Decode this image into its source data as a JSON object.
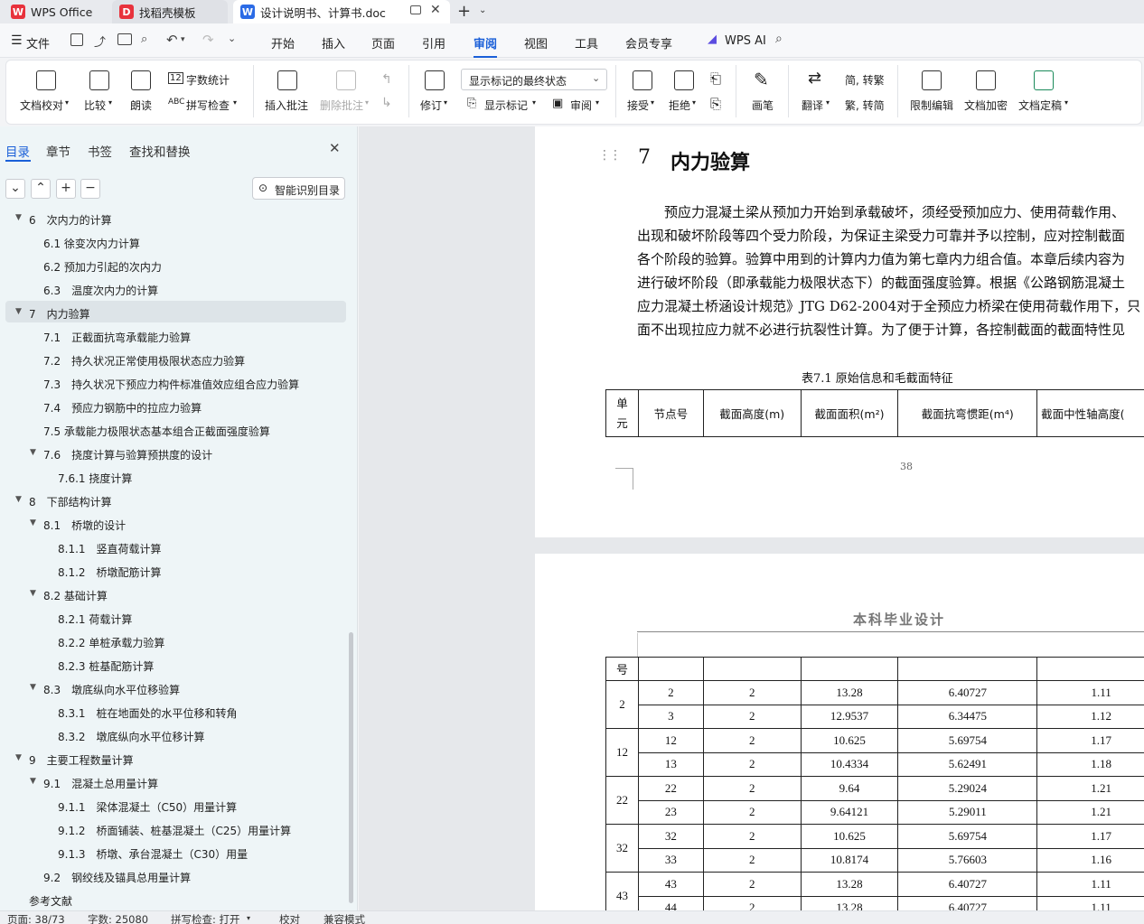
{
  "tabs": {
    "home": "WPS Office",
    "template": "找稻壳模板",
    "doc": "设计说明书、计算书.doc"
  },
  "menu": {
    "file": "文件",
    "items": [
      "开始",
      "插入",
      "页面",
      "引用",
      "审阅",
      "视图",
      "工具",
      "会员专享"
    ],
    "active": "审阅",
    "ai": "WPS AI"
  },
  "ribbon": {
    "proof": "文档校对",
    "compare": "比较",
    "read": "朗读",
    "wordcount": "字数统计",
    "spellcheck": "拼写检查",
    "insert_comment": "插入批注",
    "delete_comment": "删除批注",
    "revise": "修订",
    "display_select": "显示标记的最终状态",
    "show_markup": "显示标记",
    "review": "审阅",
    "accept": "接受",
    "reject": "拒绝",
    "pen": "画笔",
    "translate": "翻译",
    "to_trad": "简, 转繁",
    "to_simp": "繁, 转简",
    "restrict": "限制编辑",
    "encrypt": "文档加密",
    "finalize": "文档定稿"
  },
  "panel": {
    "tabs": [
      "目录",
      "章节",
      "书签",
      "查找和替换"
    ],
    "smart_toc": "智能识别目录",
    "toc": [
      "6　次内力的计算",
      "6.1 徐变次内力计算",
      "6.2 预加力引起的次内力",
      "6.3　温度次内力的计算",
      "7　内力验算",
      "7.1　正截面抗弯承载能力验算",
      "7.2　持久状况正常使用极限状态应力验算",
      "7.3　持久状况下预应力构件标准值效应组合应力验算",
      "7.4　预应力钢筋中的拉应力验算",
      "7.5 承载能力极限状态基本组合正截面强度验算",
      "7.6　挠度计算与验算预拱度的设计",
      "7.6.1 挠度计算",
      "8　下部结构计算",
      "8.1　桥墩的设计",
      "8.1.1　竖直荷载计算",
      "8.1.2　桥墩配筋计算",
      "8.2 基础计算",
      "8.2.1 荷载计算",
      "8.2.2 单桩承载力验算",
      "8.2.3 桩基配筋计算",
      "8.3　墩底纵向水平位移验算",
      "8.3.1　桩在地面处的水平位移和转角",
      "8.3.2　墩底纵向水平位移计算",
      "9　主要工程数量计算",
      "9.1　混凝土总用量计算",
      "9.1.1　梁体混凝土（C50）用量计算",
      "9.1.2　桥面铺装、桩基混凝土（C25）用量计算",
      "9.1.3　桥墩、承台混凝土（C30）用量",
      "9.2　钢绞线及锚具总用量计算",
      "参考文献"
    ]
  },
  "doc": {
    "chapter_num": "7",
    "chapter_title": "内力验算",
    "para": [
      "预应力混凝土梁从预加力开始到承载破坏，须经受预加应力、使用荷载作用、",
      "出现和破坏阶段等四个受力阶段，为保证主梁受力可靠并予以控制，应对控制截面",
      "各个阶段的验算。验算中用到的计算内力值为第七章内力组合值。本章后续内容为",
      "进行破坏阶段（即承载能力极限状态下）的截面强度验算。根据《公路钢筋混凝土",
      "应力混凝土桥涵设计规范》JTG D62-2004对于全预应力桥梁在使用荷载作用下，只",
      "面不出现拉应力就不必进行抗裂性计算。为了便于计算，各控制截面的截面特性见"
    ],
    "table_caption": "表7.1  原始信息和毛截面特征",
    "headers": [
      "单元",
      "节点号",
      "截面高度(m)",
      "截面面积(m²)",
      "截面抗弯惯距(m⁴)",
      "截面中性轴高度("
    ],
    "page_number": "38",
    "page2_header": "本科毕业设计",
    "cont_header": "号",
    "rows": [
      {
        "unit": "2",
        "cells": [
          [
            "2",
            "2",
            "13.28",
            "6.40727",
            "1.11"
          ],
          [
            "3",
            "2",
            "12.9537",
            "6.34475",
            "1.12"
          ]
        ]
      },
      {
        "unit": "12",
        "cells": [
          [
            "12",
            "2",
            "10.625",
            "5.69754",
            "1.17"
          ],
          [
            "13",
            "2",
            "10.4334",
            "5.62491",
            "1.18"
          ]
        ]
      },
      {
        "unit": "22",
        "cells": [
          [
            "22",
            "2",
            "9.64",
            "5.29024",
            "1.21"
          ],
          [
            "23",
            "2",
            "9.64121",
            "5.29011",
            "1.21"
          ]
        ]
      },
      {
        "unit": "32",
        "cells": [
          [
            "32",
            "2",
            "10.625",
            "5.69754",
            "1.17"
          ],
          [
            "33",
            "2",
            "10.8174",
            "5.76603",
            "1.16"
          ]
        ]
      },
      {
        "unit": "43",
        "cells": [
          [
            "43",
            "2",
            "13.28",
            "6.40727",
            "1.11"
          ],
          [
            "44",
            "2",
            "13.28",
            "6.40727",
            "1.11"
          ]
        ]
      }
    ]
  },
  "status": {
    "page": "页面: 38/73",
    "words": "字数: 25080",
    "spell": "拼写检查: 打开",
    "proof": "校对",
    "compat": "兼容模式"
  }
}
